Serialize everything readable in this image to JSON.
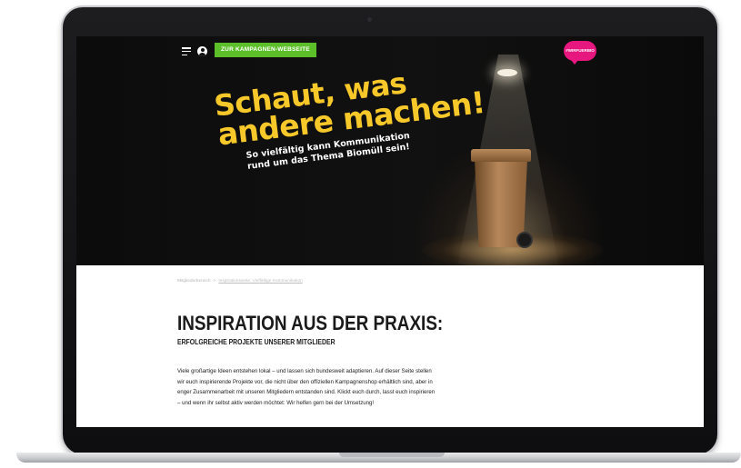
{
  "nav": {
    "campaign_button": "ZUR KAMPAGNEN-WEBSEITE",
    "brand_badge": "#WIRFUERBIO"
  },
  "hero": {
    "headline_line1": "Schaut, was",
    "headline_line2": "andere machen!",
    "subline_line1": "So vielfältig kann Kommunikation",
    "subline_line2": "rund um das Thema Biomüll sein!"
  },
  "breadcrumb": {
    "root": "Mitgliederbereich",
    "separator": ">",
    "current": "Inspirationsseite: Vielfältige Kommunikation"
  },
  "content": {
    "title": "INSPIRATION AUS DER PRAXIS:",
    "subtitle": "ERFOLGREICHE PROJEKTE UNSERER MITGLIEDER",
    "body_lines": [
      "Viele großartige Ideen entstehen lokal – und lassen sich bundesweit adaptieren. Auf dieser Seite stellen",
      "wir euch inspirierende Projekte vor, die nicht über den offiziellen Kampagnenshop erhältlich sind, aber in",
      "enger Zusammenarbeit mit unseren Mitgliedern entstanden sind. Klickt euch durch, lasst euch inspirieren",
      "– und wenn ihr selbst aktiv werden möchtet: Wir helfen gern bei der Umsetzung!"
    ]
  },
  "colors": {
    "accent_green": "#5cbf2a",
    "brand_pink": "#e6177e",
    "headline_yellow": "#f7c82a",
    "hero_background": "#0c0c0c"
  },
  "icons": {
    "menu": "hamburger-menu-icon",
    "account": "user-icon"
  }
}
